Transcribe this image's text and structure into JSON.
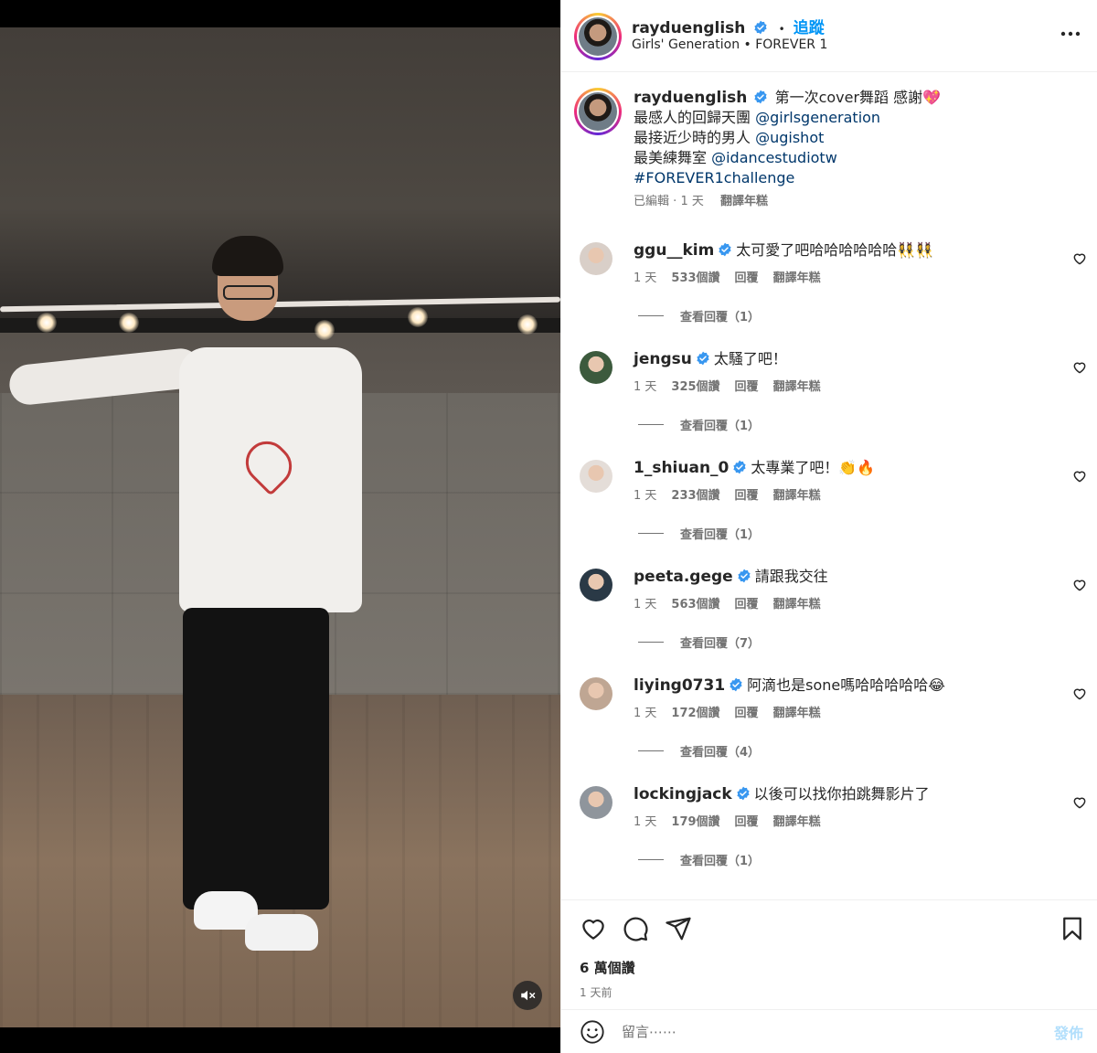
{
  "post": {
    "author": "rayduenglish",
    "follow_label": "追蹤",
    "dot": "•",
    "audio": "Girls' Generation • FOREVER 1",
    "caption": {
      "lines": [
        {
          "text": "第一次cover舞蹈 感謝💖"
        },
        {
          "prefix": "最感人的回歸天團 ",
          "mention": "@girlsgeneration"
        },
        {
          "prefix": "最接近少時的男人 ",
          "mention": "@ugishot"
        },
        {
          "prefix": "最美練舞室 ",
          "mention": "@idancestudiotw"
        },
        {
          "mention": "#FOREVER1challenge"
        }
      ],
      "edited": "已編輯",
      "sep": "·",
      "time": "1 天",
      "translate": "翻譯年糕"
    }
  },
  "comments": [
    {
      "user": "ggu__kim",
      "text": "太可愛了吧哈哈哈哈哈哈👯‍♀️👯‍♀️",
      "time": "1 天",
      "likes": "533個讚",
      "reply": "回覆",
      "translate": "翻譯年糕",
      "replies": "查看回覆（1）",
      "avatar_color": "#d9cfc8"
    },
    {
      "user": "jengsu",
      "text": "太騷了吧！",
      "time": "1 天",
      "likes": "325個讚",
      "reply": "回覆",
      "translate": "翻譯年糕",
      "replies": "查看回覆（1）",
      "avatar_color": "#3c5a3d"
    },
    {
      "user": "1_shiuan_0",
      "text": "太專業了吧！👏🔥",
      "time": "1 天",
      "likes": "233個讚",
      "reply": "回覆",
      "translate": "翻譯年糕",
      "replies": "查看回覆（1）",
      "avatar_color": "#e4ddd8"
    },
    {
      "user": "peeta.gege",
      "text": "請跟我交往",
      "time": "1 天",
      "likes": "563個讚",
      "reply": "回覆",
      "translate": "翻譯年糕",
      "replies": "查看回覆（7）",
      "avatar_color": "#2a3946"
    },
    {
      "user": "liying0731",
      "text": "阿滴也是sone嗎哈哈哈哈哈😂",
      "time": "1 天",
      "likes": "172個讚",
      "reply": "回覆",
      "translate": "翻譯年糕",
      "replies": "查看回覆（4）",
      "avatar_color": "#bfa693"
    },
    {
      "user": "lockingjack",
      "text": "以後可以找你拍跳舞影片了",
      "time": "1 天",
      "likes": "179個讚",
      "reply": "回覆",
      "translate": "翻譯年糕",
      "replies": "查看回覆（1）",
      "avatar_color": "#8f959c"
    }
  ],
  "footer": {
    "likes": "6 萬個讚",
    "time": "1 天前",
    "comment_placeholder": "留言⋯⋯",
    "post_label": "發佈"
  },
  "icons": {
    "more": "more-options-icon",
    "verified": "verified-badge-icon",
    "heart": "heart-icon",
    "comment": "comment-icon",
    "share": "share-icon",
    "save": "bookmark-icon",
    "emoji": "emoji-icon",
    "mute": "mute-icon"
  },
  "colors": {
    "accent": "#0095f6",
    "mention": "#00376b",
    "verified": "#3897f0",
    "post_disabled": "#b2dffc"
  }
}
